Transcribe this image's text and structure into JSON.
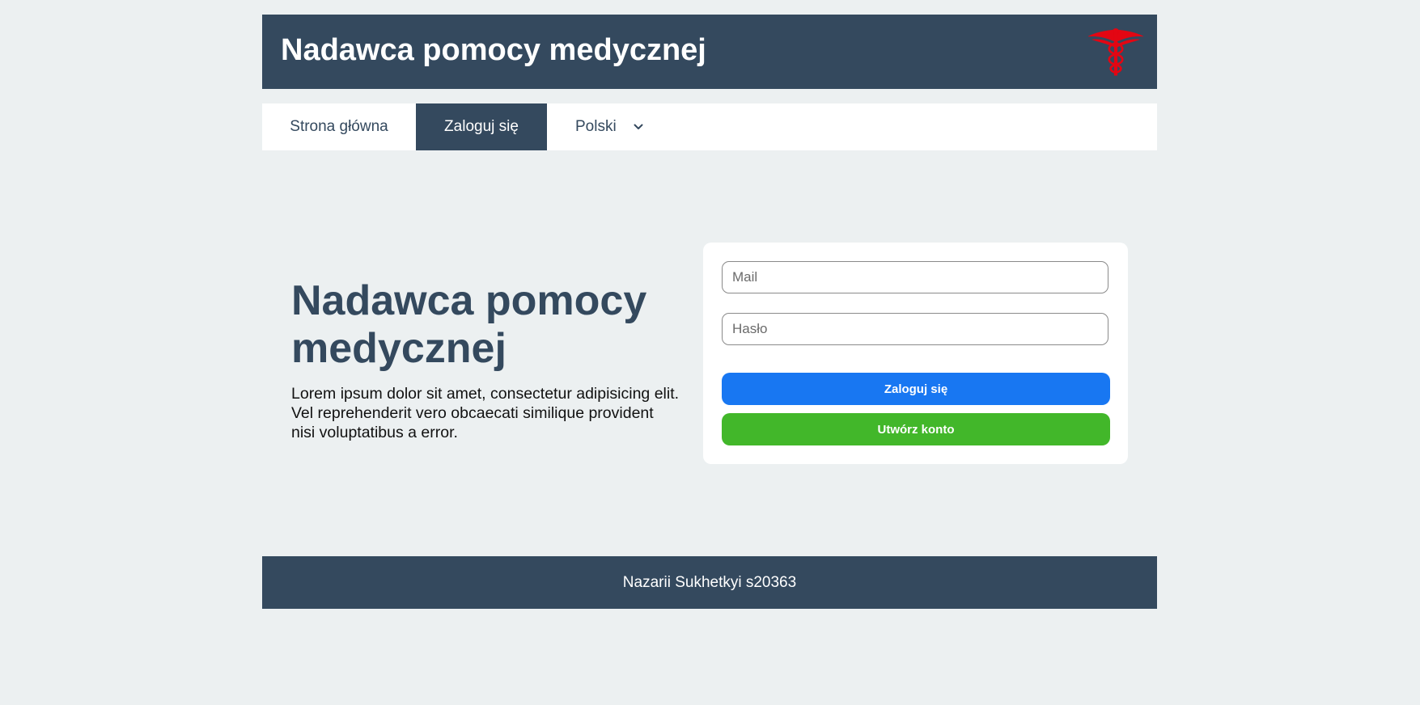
{
  "header": {
    "title": "Nadawca pomocy medycznej",
    "logo_icon": "caduceus-icon",
    "logo_color": "#e30613"
  },
  "nav": {
    "home_label": "Strona główna",
    "login_label": "Zaloguj się",
    "language_selected": "Polski",
    "language_chevron_icon": "chevron-down-icon"
  },
  "hero": {
    "title": "Nadawca pomocy medycznej",
    "text": "Lorem ipsum dolor sit amet, consectetur adipisicing elit. Vel reprehenderit vero obcaecati similique provident nisi voluptatibus a error."
  },
  "login_form": {
    "mail_placeholder": "Mail",
    "mail_value": "",
    "password_placeholder": "Hasło",
    "password_value": "",
    "login_button": "Zaloguj się",
    "register_button": "Utwórz konto"
  },
  "footer": {
    "text": "Nazarii Sukhetkyi s20363"
  },
  "colors": {
    "primary": "#34495e",
    "background": "#ecf0f1",
    "login_button": "#1877f2",
    "register_button": "#42b72a"
  }
}
